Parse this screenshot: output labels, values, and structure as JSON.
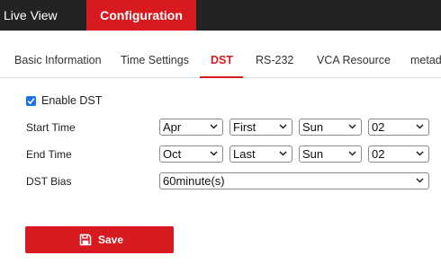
{
  "topnav": {
    "live_view": "Live View",
    "configuration": "Configuration"
  },
  "tabs": [
    "Basic Information",
    "Time Settings",
    "DST",
    "RS-232",
    "VCA Resource",
    "metad"
  ],
  "active_tab": "DST",
  "form": {
    "enable_dst": {
      "label": "Enable DST",
      "checked": true
    },
    "start_time": {
      "label": "Start Time",
      "month": "Apr",
      "week": "First",
      "day": "Sun",
      "hour": "02"
    },
    "end_time": {
      "label": "End Time",
      "month": "Oct",
      "week": "Last",
      "day": "Sun",
      "hour": "02"
    },
    "dst_bias": {
      "label": "DST Bias",
      "value": "60minute(s)"
    }
  },
  "save_button": {
    "label": "Save",
    "icon": "floppy-disk-icon"
  },
  "colors": {
    "accent": "#d71920",
    "topbar": "#232323",
    "checkbox": "#1a73e8"
  }
}
